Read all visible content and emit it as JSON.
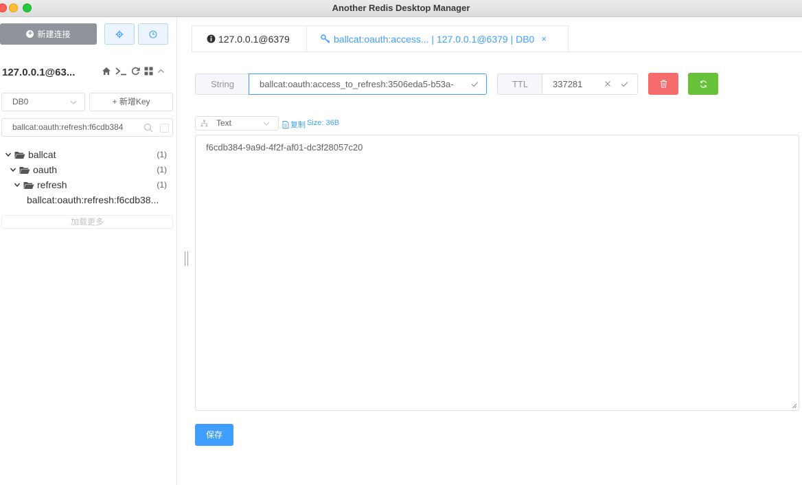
{
  "window": {
    "title": "Another Redis Desktop Manager"
  },
  "sidebar": {
    "new_connection_label": "新建连接",
    "connection_name": "127.0.0.1@63...",
    "db_select": "DB0",
    "add_key_label": "+ 新增Key",
    "search_value": "ballcat:oauth:refresh:f6cdb384",
    "tree": [
      {
        "label": "ballcat",
        "count": "(1)"
      },
      {
        "label": "oauth",
        "count": "(1)"
      },
      {
        "label": "refresh",
        "count": "(1)"
      },
      {
        "label": "ballcat:oauth:refresh:f6cdb38..."
      }
    ],
    "load_more_label": "加载更多"
  },
  "tabs": [
    {
      "label": "127.0.0.1@6379"
    },
    {
      "label": "ballcat:oauth:access... | 127.0.0.1@6379 | DB0",
      "close": "×"
    }
  ],
  "key_editor": {
    "type_label": "String",
    "key_value": "ballcat:oauth:access_to_refresh:3506eda5-b53a-",
    "ttl_label": "TTL",
    "ttl_value": "337281"
  },
  "value_editor": {
    "format": "Text",
    "copy_label": "复制",
    "size_text": "Size: 36B",
    "value": "f6cdb384-9a9d-4f2f-af01-dc3f28057c20",
    "save_label": "保存"
  },
  "colors": {
    "primary": "#409eff",
    "danger": "#f56c6c",
    "success": "#67c23a",
    "info": "#909399"
  }
}
